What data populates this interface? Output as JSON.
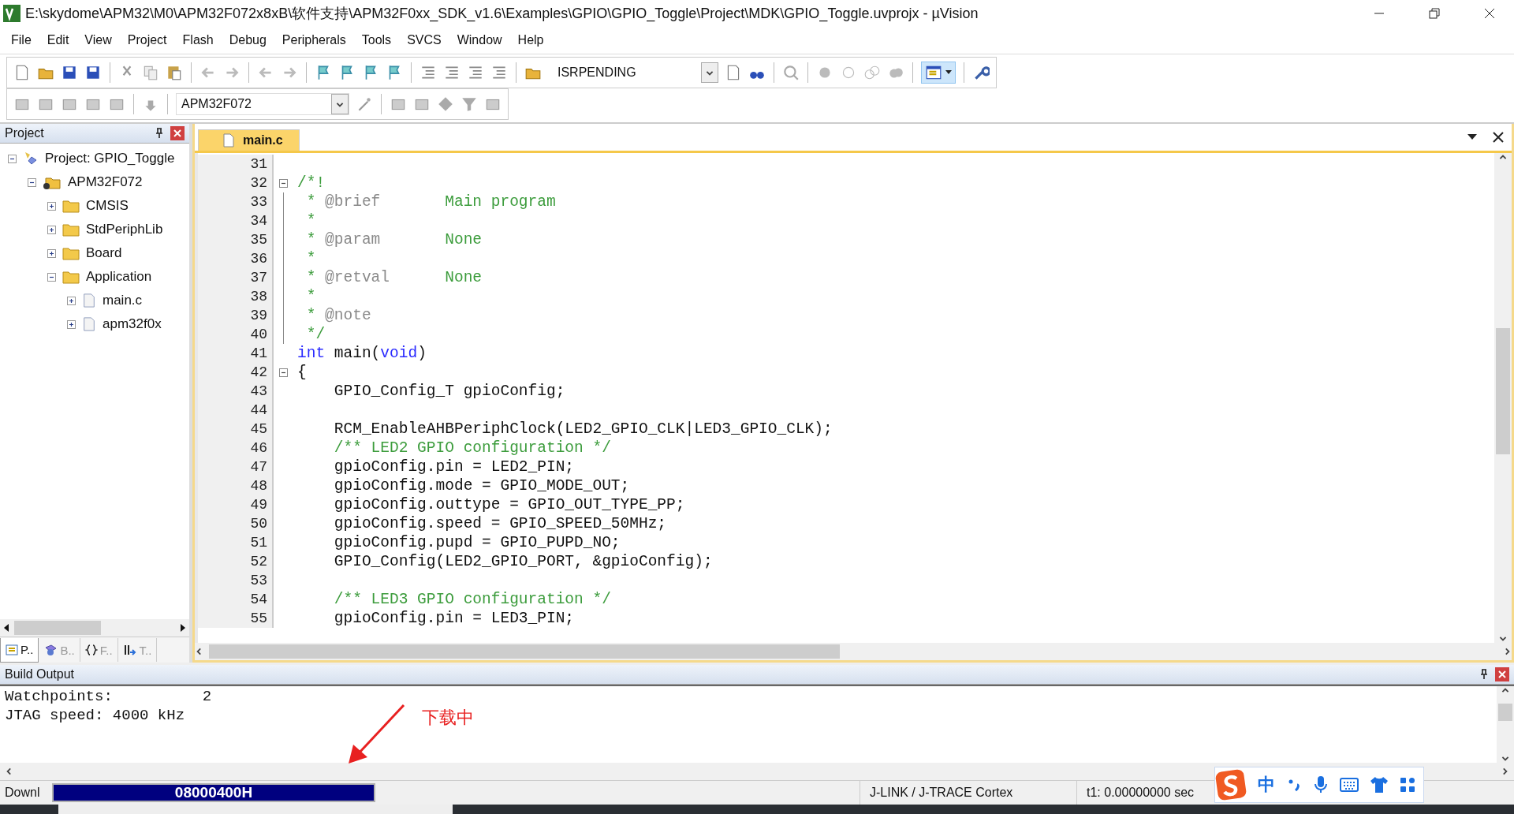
{
  "window": {
    "title": "E:\\skydome\\APM32\\M0\\APM32F072x8xB\\软件支持\\APM32F0xx_SDK_v1.6\\Examples\\GPIO\\GPIO_Toggle\\Project\\MDK\\GPIO_Toggle.uvprojx - µVision"
  },
  "menu": [
    "File",
    "Edit",
    "View",
    "Project",
    "Flash",
    "Debug",
    "Peripherals",
    "Tools",
    "SVCS",
    "Window",
    "Help"
  ],
  "toolbar": {
    "find_field": {
      "value": "ISRPENDING"
    },
    "target_field": {
      "value": "APM32F072"
    }
  },
  "project_panel": {
    "title": "Project",
    "tree": [
      {
        "label": "Project: GPIO_Toggle",
        "kind": "project",
        "expanded": true,
        "children": [
          {
            "label": "APM32F072",
            "kind": "target",
            "expanded": true,
            "children": [
              {
                "label": "CMSIS",
                "kind": "folder",
                "expanded": false
              },
              {
                "label": "StdPeriphLib",
                "kind": "folder",
                "expanded": false
              },
              {
                "label": "Board",
                "kind": "folder",
                "expanded": false
              },
              {
                "label": "Application",
                "kind": "folder",
                "expanded": true,
                "children": [
                  {
                    "label": "main.c",
                    "kind": "file",
                    "expanded": false
                  },
                  {
                    "label": "apm32f0x",
                    "kind": "file",
                    "expanded": false
                  }
                ]
              }
            ]
          }
        ]
      }
    ],
    "tabs": [
      {
        "label": "P..",
        "kind": "project",
        "selected": true
      },
      {
        "label": "B..",
        "kind": "books",
        "selected": false
      },
      {
        "label": "F..",
        "kind": "functions",
        "selected": false
      },
      {
        "label": "T..",
        "kind": "templates",
        "selected": false
      }
    ]
  },
  "editor": {
    "tabs": [
      {
        "label": "main.c",
        "selected": true
      }
    ],
    "lines": [
      {
        "number": "31",
        "fold": false
      },
      {
        "number": "32",
        "fold": true,
        "segments": [
          {
            "kind": "comment",
            "text": "/*!"
          }
        ]
      },
      {
        "number": "33",
        "fold": false,
        "segments": [
          {
            "kind": "comment",
            "text": " * "
          },
          {
            "kind": "doctag",
            "text": "@brief"
          },
          {
            "kind": "comment",
            "text": "       Main program"
          }
        ]
      },
      {
        "number": "34",
        "fold": false,
        "segments": [
          {
            "kind": "comment",
            "text": " *"
          }
        ]
      },
      {
        "number": "35",
        "fold": false,
        "segments": [
          {
            "kind": "comment",
            "text": " * "
          },
          {
            "kind": "doctag",
            "text": "@param"
          },
          {
            "kind": "comment",
            "text": "       None"
          }
        ]
      },
      {
        "number": "36",
        "fold": false,
        "segments": [
          {
            "kind": "comment",
            "text": " *"
          }
        ]
      },
      {
        "number": "37",
        "fold": false,
        "segments": [
          {
            "kind": "comment",
            "text": " * "
          },
          {
            "kind": "doctag",
            "text": "@retval"
          },
          {
            "kind": "comment",
            "text": "      None"
          }
        ]
      },
      {
        "number": "38",
        "fold": false,
        "segments": [
          {
            "kind": "comment",
            "text": " *"
          }
        ]
      },
      {
        "number": "39",
        "fold": false,
        "segments": [
          {
            "kind": "comment",
            "text": " * "
          },
          {
            "kind": "doctag",
            "text": "@note"
          }
        ]
      },
      {
        "number": "40",
        "fold": false,
        "segments": [
          {
            "kind": "comment",
            "text": " */"
          }
        ]
      },
      {
        "number": "41",
        "fold": false,
        "segments": [
          {
            "kind": "keyword",
            "text": "int"
          },
          {
            "kind": "plain",
            "text": " main("
          },
          {
            "kind": "keyword",
            "text": "void"
          },
          {
            "kind": "plain",
            "text": ")"
          }
        ]
      },
      {
        "number": "42",
        "fold": true,
        "segments": [
          {
            "kind": "plain",
            "text": "{"
          }
        ]
      },
      {
        "number": "43",
        "fold": false,
        "segments": [
          {
            "kind": "plain",
            "text": "    GPIO_Config_T gpioConfig;"
          }
        ]
      },
      {
        "number": "44",
        "fold": false
      },
      {
        "number": "45",
        "fold": false,
        "segments": [
          {
            "kind": "plain",
            "text": "    RCM_EnableAHBPeriphClock(LED2_GPIO_CLK|LED3_GPIO_CLK);"
          }
        ]
      },
      {
        "number": "46",
        "fold": false,
        "segments": [
          {
            "kind": "comment",
            "text": "    /** LED2 GPIO configuration */"
          }
        ]
      },
      {
        "number": "47",
        "fold": false,
        "segments": [
          {
            "kind": "plain",
            "text": "    gpioConfig.pin = LED2_PIN;"
          }
        ]
      },
      {
        "number": "48",
        "fold": false,
        "segments": [
          {
            "kind": "plain",
            "text": "    gpioConfig.mode = GPIO_MODE_OUT;"
          }
        ]
      },
      {
        "number": "49",
        "fold": false,
        "segments": [
          {
            "kind": "plain",
            "text": "    gpioConfig.outtype = GPIO_OUT_TYPE_PP;"
          }
        ]
      },
      {
        "number": "50",
        "fold": false,
        "segments": [
          {
            "kind": "plain",
            "text": "    gpioConfig.speed = GPIO_SPEED_50MHz;"
          }
        ]
      },
      {
        "number": "51",
        "fold": false,
        "segments": [
          {
            "kind": "plain",
            "text": "    gpioConfig.pupd = GPIO_PUPD_NO;"
          }
        ]
      },
      {
        "number": "52",
        "fold": false,
        "segments": [
          {
            "kind": "plain",
            "text": "    GPIO_Config(LED2_GPIO_PORT, &gpioConfig);"
          }
        ]
      },
      {
        "number": "53",
        "fold": false
      },
      {
        "number": "54",
        "fold": false,
        "segments": [
          {
            "kind": "comment",
            "text": "    /** LED3 GPIO configuration */"
          }
        ]
      },
      {
        "number": "55",
        "fold": false,
        "segments": [
          {
            "kind": "plain",
            "text": "    gpioConfig.pin = LED3_PIN;"
          }
        ]
      }
    ]
  },
  "build_output": {
    "title": "Build Output",
    "lines": [
      "Watchpoints:          2",
      "JTAG speed: 4000 kHz"
    ]
  },
  "annotation": {
    "text": "下载中"
  },
  "status_bar": {
    "label": "Downl",
    "progress": {
      "text": "08000400H",
      "level": 1
    },
    "debugger": "J-LINK / J-TRACE Cortex",
    "time": "t1: 0.00000000 sec"
  },
  "ime_bar": {
    "mode": "中"
  }
}
